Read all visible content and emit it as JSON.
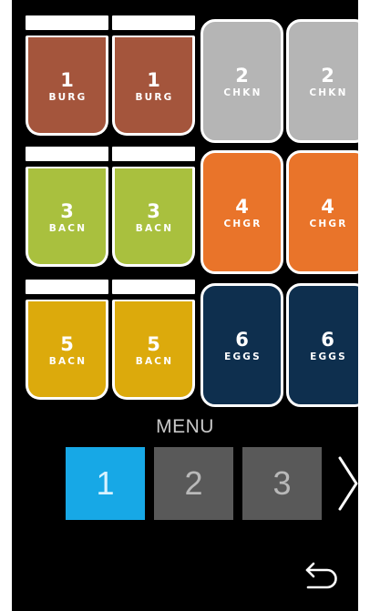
{
  "tiles": [
    {
      "num": "1",
      "label": "BURG",
      "color": "#a4553c",
      "lid": true
    },
    {
      "num": "1",
      "label": "BURG",
      "color": "#a4553c",
      "lid": true
    },
    {
      "num": "2",
      "label": "CHKN",
      "color": "#b5b5b5",
      "lid": false
    },
    {
      "num": "2",
      "label": "CHKN",
      "color": "#b5b5b5",
      "lid": false
    },
    {
      "num": "3",
      "label": "BACN",
      "color": "#a9c03e",
      "lid": true
    },
    {
      "num": "3",
      "label": "BACN",
      "color": "#a9c03e",
      "lid": true
    },
    {
      "num": "4",
      "label": "CHGR",
      "color": "#e9742a",
      "lid": false
    },
    {
      "num": "4",
      "label": "CHGR",
      "color": "#e9742a",
      "lid": false
    },
    {
      "num": "5",
      "label": "BACN",
      "color": "#dcaa0c",
      "lid": true
    },
    {
      "num": "5",
      "label": "BACN",
      "color": "#dcaa0c",
      "lid": true
    },
    {
      "num": "6",
      "label": "EGGS",
      "color": "#0e2f4e",
      "lid": false
    },
    {
      "num": "6",
      "label": "EGGS",
      "color": "#0e2f4e",
      "lid": false
    }
  ],
  "menu": {
    "title": "MENU",
    "pages": [
      {
        "label": "1",
        "active": true
      },
      {
        "label": "2",
        "active": false
      },
      {
        "label": "3",
        "active": false
      }
    ],
    "next_icon": "chevron-right-icon"
  },
  "back_icon": "return-arrow-icon",
  "colors": {
    "background": "#000000",
    "active_page": "#17a8e6",
    "inactive_page": "#595959"
  }
}
